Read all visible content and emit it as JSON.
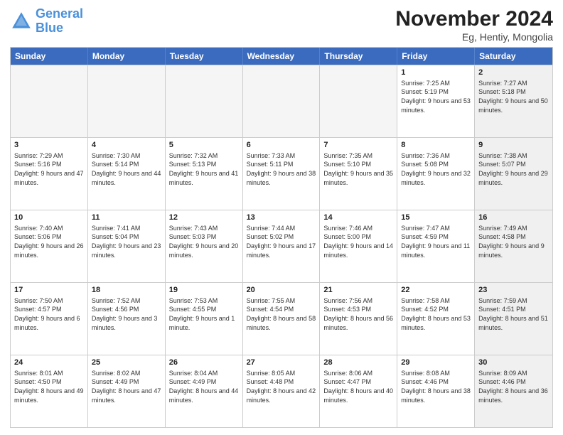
{
  "header": {
    "logo_line1": "General",
    "logo_line2": "Blue",
    "month": "November 2024",
    "location": "Eg, Hentiy, Mongolia"
  },
  "weekdays": [
    "Sunday",
    "Monday",
    "Tuesday",
    "Wednesday",
    "Thursday",
    "Friday",
    "Saturday"
  ],
  "rows": [
    [
      {
        "day": "",
        "info": "",
        "empty": true
      },
      {
        "day": "",
        "info": "",
        "empty": true
      },
      {
        "day": "",
        "info": "",
        "empty": true
      },
      {
        "day": "",
        "info": "",
        "empty": true
      },
      {
        "day": "",
        "info": "",
        "empty": true
      },
      {
        "day": "1",
        "info": "Sunrise: 7:25 AM\nSunset: 5:19 PM\nDaylight: 9 hours and 53 minutes.",
        "shaded": false
      },
      {
        "day": "2",
        "info": "Sunrise: 7:27 AM\nSunset: 5:18 PM\nDaylight: 9 hours and 50 minutes.",
        "shaded": true
      }
    ],
    [
      {
        "day": "3",
        "info": "Sunrise: 7:29 AM\nSunset: 5:16 PM\nDaylight: 9 hours and 47 minutes.",
        "shaded": false
      },
      {
        "day": "4",
        "info": "Sunrise: 7:30 AM\nSunset: 5:14 PM\nDaylight: 9 hours and 44 minutes.",
        "shaded": false
      },
      {
        "day": "5",
        "info": "Sunrise: 7:32 AM\nSunset: 5:13 PM\nDaylight: 9 hours and 41 minutes.",
        "shaded": false
      },
      {
        "day": "6",
        "info": "Sunrise: 7:33 AM\nSunset: 5:11 PM\nDaylight: 9 hours and 38 minutes.",
        "shaded": false
      },
      {
        "day": "7",
        "info": "Sunrise: 7:35 AM\nSunset: 5:10 PM\nDaylight: 9 hours and 35 minutes.",
        "shaded": false
      },
      {
        "day": "8",
        "info": "Sunrise: 7:36 AM\nSunset: 5:08 PM\nDaylight: 9 hours and 32 minutes.",
        "shaded": false
      },
      {
        "day": "9",
        "info": "Sunrise: 7:38 AM\nSunset: 5:07 PM\nDaylight: 9 hours and 29 minutes.",
        "shaded": true
      }
    ],
    [
      {
        "day": "10",
        "info": "Sunrise: 7:40 AM\nSunset: 5:06 PM\nDaylight: 9 hours and 26 minutes.",
        "shaded": false
      },
      {
        "day": "11",
        "info": "Sunrise: 7:41 AM\nSunset: 5:04 PM\nDaylight: 9 hours and 23 minutes.",
        "shaded": false
      },
      {
        "day": "12",
        "info": "Sunrise: 7:43 AM\nSunset: 5:03 PM\nDaylight: 9 hours and 20 minutes.",
        "shaded": false
      },
      {
        "day": "13",
        "info": "Sunrise: 7:44 AM\nSunset: 5:02 PM\nDaylight: 9 hours and 17 minutes.",
        "shaded": false
      },
      {
        "day": "14",
        "info": "Sunrise: 7:46 AM\nSunset: 5:00 PM\nDaylight: 9 hours and 14 minutes.",
        "shaded": false
      },
      {
        "day": "15",
        "info": "Sunrise: 7:47 AM\nSunset: 4:59 PM\nDaylight: 9 hours and 11 minutes.",
        "shaded": false
      },
      {
        "day": "16",
        "info": "Sunrise: 7:49 AM\nSunset: 4:58 PM\nDaylight: 9 hours and 9 minutes.",
        "shaded": true
      }
    ],
    [
      {
        "day": "17",
        "info": "Sunrise: 7:50 AM\nSunset: 4:57 PM\nDaylight: 9 hours and 6 minutes.",
        "shaded": false
      },
      {
        "day": "18",
        "info": "Sunrise: 7:52 AM\nSunset: 4:56 PM\nDaylight: 9 hours and 3 minutes.",
        "shaded": false
      },
      {
        "day": "19",
        "info": "Sunrise: 7:53 AM\nSunset: 4:55 PM\nDaylight: 9 hours and 1 minute.",
        "shaded": false
      },
      {
        "day": "20",
        "info": "Sunrise: 7:55 AM\nSunset: 4:54 PM\nDaylight: 8 hours and 58 minutes.",
        "shaded": false
      },
      {
        "day": "21",
        "info": "Sunrise: 7:56 AM\nSunset: 4:53 PM\nDaylight: 8 hours and 56 minutes.",
        "shaded": false
      },
      {
        "day": "22",
        "info": "Sunrise: 7:58 AM\nSunset: 4:52 PM\nDaylight: 8 hours and 53 minutes.",
        "shaded": false
      },
      {
        "day": "23",
        "info": "Sunrise: 7:59 AM\nSunset: 4:51 PM\nDaylight: 8 hours and 51 minutes.",
        "shaded": true
      }
    ],
    [
      {
        "day": "24",
        "info": "Sunrise: 8:01 AM\nSunset: 4:50 PM\nDaylight: 8 hours and 49 minutes.",
        "shaded": false
      },
      {
        "day": "25",
        "info": "Sunrise: 8:02 AM\nSunset: 4:49 PM\nDaylight: 8 hours and 47 minutes.",
        "shaded": false
      },
      {
        "day": "26",
        "info": "Sunrise: 8:04 AM\nSunset: 4:49 PM\nDaylight: 8 hours and 44 minutes.",
        "shaded": false
      },
      {
        "day": "27",
        "info": "Sunrise: 8:05 AM\nSunset: 4:48 PM\nDaylight: 8 hours and 42 minutes.",
        "shaded": false
      },
      {
        "day": "28",
        "info": "Sunrise: 8:06 AM\nSunset: 4:47 PM\nDaylight: 8 hours and 40 minutes.",
        "shaded": false
      },
      {
        "day": "29",
        "info": "Sunrise: 8:08 AM\nSunset: 4:46 PM\nDaylight: 8 hours and 38 minutes.",
        "shaded": false
      },
      {
        "day": "30",
        "info": "Sunrise: 8:09 AM\nSunset: 4:46 PM\nDaylight: 8 hours and 36 minutes.",
        "shaded": true
      }
    ]
  ]
}
